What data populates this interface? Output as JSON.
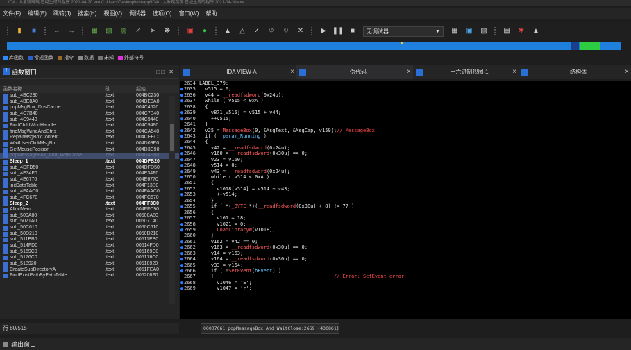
{
  "window": {
    "title": "IDA - 大象跳跳跳 已经生成的程序 2021-04-20.exe C:\\Users\\Desktop\\test\\app\\IDA\\...大象跳跳跳 已经生成的程序 2021-04-20.exe"
  },
  "menu": [
    "文件(F)",
    "编辑(E)",
    "跳转(J)",
    "搜索(H)",
    "视图(V)",
    "调试器",
    "选项(O)",
    "窗口(W)",
    "帮助"
  ],
  "toolbar": {
    "debugger_select": "无调试器"
  },
  "legend": [
    {
      "label": "库函数",
      "color": "#2a8cff"
    },
    {
      "label": "常规函数",
      "color": "#2a5fd0"
    },
    {
      "label": "指令",
      "color": "#9a6a2a"
    },
    {
      "label": "数据",
      "color": "#8a8a8a"
    },
    {
      "label": "未知",
      "color": "#777777"
    },
    {
      "label": "外部符号",
      "color": "#e030e0"
    }
  ],
  "functions_panel": {
    "title": "函数窗口",
    "columns": [
      "函数名称",
      "段",
      "起始"
    ],
    "rows": [
      {
        "name": "sub_4BC230",
        "seg": ".text",
        "start": "004BC230",
        "style": ""
      },
      {
        "name": "sub_4BE8A0",
        "seg": ".text",
        "start": "004BE8A0",
        "style": ""
      },
      {
        "name": "popMsgBox_DnsCache",
        "seg": ".text",
        "start": "004C4520",
        "style": ""
      },
      {
        "name": "sub_4C7B40",
        "seg": ".text",
        "start": "004C7B40",
        "style": ""
      },
      {
        "name": "sub_4C9440",
        "seg": ".text",
        "start": "004C9440",
        "style": ""
      },
      {
        "name": "FindChildWndHandle",
        "seg": ".text",
        "start": "004C9480",
        "style": ""
      },
      {
        "name": "findMsgWindAndBtns",
        "seg": ".text",
        "start": "004CA540",
        "style": ""
      },
      {
        "name": "RepairMsgBoxContent",
        "seg": ".text",
        "start": "004CEEC0",
        "style": ""
      },
      {
        "name": "WaitUserClickMsgBtn",
        "seg": ".text",
        "start": "004D09E0",
        "style": ""
      },
      {
        "name": "GetMousePosition",
        "seg": ".text",
        "start": "004D3C90",
        "style": ""
      },
      {
        "name": "popMessageBox_And_WaitClose",
        "seg": ".text",
        "start": "004D4E80",
        "style": "sel"
      },
      {
        "name": "Sleep_1",
        "seg": ".text",
        "start": "004DFB20",
        "style": "bold"
      },
      {
        "name": "sub_4DFD50",
        "seg": ".text",
        "start": "004DFD50",
        "style": ""
      },
      {
        "name": "sub_4E34F0",
        "seg": ".text",
        "start": "004E34F0",
        "style": ""
      },
      {
        "name": "sub_4E6770",
        "seg": ".text",
        "start": "004E6770",
        "style": ""
      },
      {
        "name": "initDataTable",
        "seg": ".text",
        "start": "004F13B0",
        "style": ""
      },
      {
        "name": "sub_4FAAC0",
        "seg": ".text",
        "start": "004FAAC0",
        "style": ""
      },
      {
        "name": "sub_4FC670",
        "seg": ".text",
        "start": "004FC670",
        "style": ""
      },
      {
        "name": "Sleep_2",
        "seg": ".text",
        "start": "004FF3C0",
        "style": "bold"
      },
      {
        "name": "AllocMem",
        "seg": ".text",
        "start": "004FFC90",
        "style": ""
      },
      {
        "name": "sub_500A80",
        "seg": ".text",
        "start": "00500A80",
        "style": ""
      },
      {
        "name": "sub_5071A0",
        "seg": ".text",
        "start": "005071A0",
        "style": ""
      },
      {
        "name": "sub_50C610",
        "seg": ".text",
        "start": "0050C610",
        "style": ""
      },
      {
        "name": "sub_50D210",
        "seg": ".text",
        "start": "0050D210",
        "style": ""
      },
      {
        "name": "sub_511EB0",
        "seg": ".text",
        "start": "00511EB0",
        "style": ""
      },
      {
        "name": "sub_514FD0",
        "seg": ".text",
        "start": "00514FD0",
        "style": ""
      },
      {
        "name": "sub_5169C0",
        "seg": ".text",
        "start": "005169C0",
        "style": ""
      },
      {
        "name": "sub_5176C0",
        "seg": ".text",
        "start": "005176C0",
        "style": ""
      },
      {
        "name": "sub_518920",
        "seg": ".text",
        "start": "00518920",
        "style": ""
      },
      {
        "name": "CreateSubDirectoryA",
        "seg": ".text",
        "start": "0051FEA0",
        "style": ""
      },
      {
        "name": "FindExistPathByPathTable",
        "seg": ".text",
        "start": "005208F0",
        "style": ""
      }
    ],
    "status": "行 80/515"
  },
  "tabs": [
    {
      "label": "IDA VIEW-A",
      "active": false
    },
    {
      "label": "伪代码",
      "active": true
    },
    {
      "label": "十六进制视图-1",
      "active": false
    },
    {
      "label": "结构体",
      "active": false
    }
  ],
  "code_lines": [
    {
      "n": "2634",
      "dot": false,
      "t": "LABEL_379:"
    },
    {
      "n": "2635",
      "dot": true,
      "t": "  v515 = 0;"
    },
    {
      "n": "2636",
      "dot": true,
      "t": "  v44 = __readfsdword(0x24u);"
    },
    {
      "n": "2637",
      "dot": true,
      "t": "  while ( v515 < 0xA )"
    },
    {
      "n": "2638",
      "dot": false,
      "t": "  {"
    },
    {
      "n": "2639",
      "dot": true,
      "t": "    v871[v515] = v515 + v44;"
    },
    {
      "n": "2640",
      "dot": true,
      "t": "    ++v515;"
    },
    {
      "n": "2641",
      "dot": false,
      "t": "  }"
    },
    {
      "n": "2642",
      "dot": true,
      "t": "  v25 = MessageBox(0, &MsgText, &MsgCap, v159);// MessageBox"
    },
    {
      "n": "2643",
      "dot": true,
      "t": "  if ( !param_Running )"
    },
    {
      "n": "2644",
      "dot": false,
      "t": "  {"
    },
    {
      "n": "2645",
      "dot": true,
      "t": "    v42 = __readfsdword(0x24u);"
    },
    {
      "n": "2646",
      "dot": true,
      "t": "    v160 = __readfsdword(0x30u) == 0;"
    },
    {
      "n": "2647",
      "dot": true,
      "t": "    v23 = v160;"
    },
    {
      "n": "2648",
      "dot": true,
      "t": "    v514 = 0;"
    },
    {
      "n": "2649",
      "dot": true,
      "t": "    v43 = __readfsdword(0x24u);"
    },
    {
      "n": "2650",
      "dot": true,
      "t": "    while ( v514 < 0xA )"
    },
    {
      "n": "2651",
      "dot": false,
      "t": "    {"
    },
    {
      "n": "2652",
      "dot": true,
      "t": "      v1018[v514] = v514 + v43;"
    },
    {
      "n": "2653",
      "dot": true,
      "t": "      ++v514;"
    },
    {
      "n": "2654",
      "dot": false,
      "t": "    }"
    },
    {
      "n": "2655",
      "dot": true,
      "t": "    if ( *(_BYTE *)(__readfsdword(0x30u) + 8) != 77 )"
    },
    {
      "n": "2656",
      "dot": false,
      "t": "    {"
    },
    {
      "n": "2657",
      "dot": true,
      "t": "      v161 = 18;"
    },
    {
      "n": "2658",
      "dot": true,
      "t": "      v1021 = 0;"
    },
    {
      "n": "2659",
      "dot": true,
      "t": "      LoadLibraryW(v1018);"
    },
    {
      "n": "2660",
      "dot": false,
      "t": "    }"
    },
    {
      "n": "2661",
      "dot": true,
      "t": "    v162 = v42 == 0;"
    },
    {
      "n": "2662",
      "dot": true,
      "t": "    v163 = __readfsdword(0x30u) == 0;"
    },
    {
      "n": "2663",
      "dot": true,
      "t": "    v14 = v163;"
    },
    {
      "n": "2664",
      "dot": true,
      "t": "    v164 = __readfsdword(0x30u) == 0;"
    },
    {
      "n": "2665",
      "dot": true,
      "t": "    v33 = v164;"
    },
    {
      "n": "2666",
      "dot": true,
      "t": "    if ( !SetEvent(hEvent) )"
    },
    {
      "n": "2667",
      "dot": false,
      "t": "    {                                         // Error: SetEvent error"
    },
    {
      "n": "2668",
      "dot": true,
      "t": "      v1046 = 'E';"
    },
    {
      "n": "2669",
      "dot": true,
      "t": "      v1047 = 'r';"
    }
  ],
  "code_status": "00007C61 popMessageBox_And_WaitClose:2669 (430861)",
  "output_window": {
    "title": "输出窗口"
  }
}
